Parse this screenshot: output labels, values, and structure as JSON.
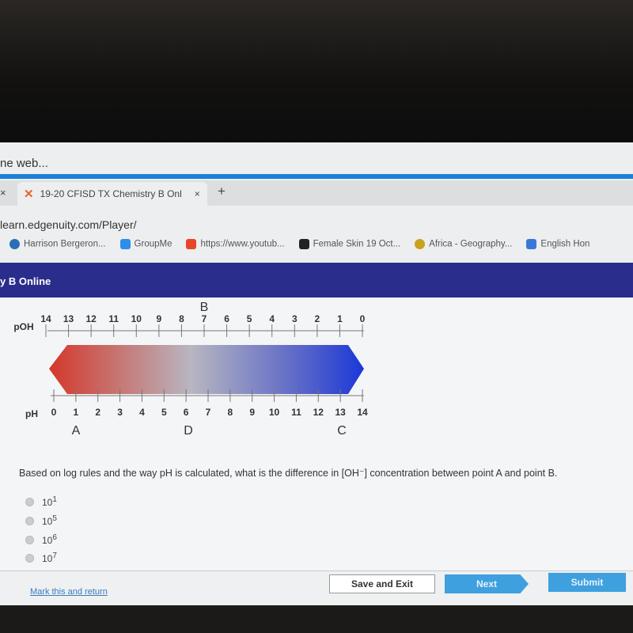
{
  "browser": {
    "search_text": "ne web...",
    "tabs": [
      {
        "label": "19-20 CFISD TX Chemistry B Onl",
        "close": "×"
      }
    ],
    "prev_tab_close": "×",
    "new_tab": "+",
    "url": "learn.edgenuity.com/Player/",
    "bookmarks": [
      {
        "label": "Harrison Bergeron...",
        "color": "#2a6fb5"
      },
      {
        "label": "GroupMe",
        "color": "#2c8ee8"
      },
      {
        "label": "https://www.youtub...",
        "color": "#e8442a"
      },
      {
        "label": "Female Skin 19 Oct...",
        "color": "#222222"
      },
      {
        "label": "Africa - Geography...",
        "color": "#c9a21e"
      },
      {
        "label": "English Hon",
        "color": "#3a78d8"
      }
    ]
  },
  "header": {
    "title": "y B Online"
  },
  "scale": {
    "poh_label": "pOH",
    "poh_ticks": [
      "14",
      "13",
      "12",
      "11",
      "10",
      "9",
      "8",
      "7",
      "6",
      "5",
      "4",
      "3",
      "2",
      "1",
      "0"
    ],
    "ph_label": "pH",
    "ph_ticks": [
      "0",
      "1",
      "2",
      "3",
      "4",
      "5",
      "6",
      "7",
      "8",
      "9",
      "10",
      "11",
      "12",
      "13",
      "14"
    ],
    "points": {
      "A": "A",
      "B": "B",
      "C": "C",
      "D": "D"
    },
    "gradient_colors": [
      "#d4382a",
      "#b8b6c0",
      "#1a38d8"
    ]
  },
  "question": {
    "text": "Based on log rules and the way pH is calculated, what is the difference in [OH⁻] concentration between point A and point B.",
    "options": [
      {
        "base": "10",
        "exp": "1"
      },
      {
        "base": "10",
        "exp": "5"
      },
      {
        "base": "10",
        "exp": "6"
      },
      {
        "base": "10",
        "exp": "7"
      }
    ]
  },
  "footer": {
    "mark": "Mark this and return",
    "save": "Save and Exit",
    "next": "Next",
    "submit": "Submit"
  }
}
